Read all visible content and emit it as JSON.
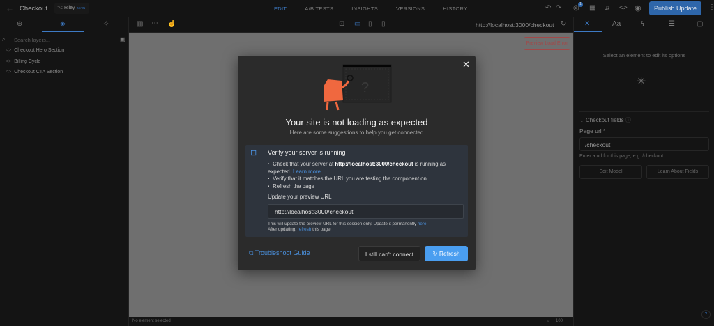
{
  "topbar": {
    "title": "Checkout",
    "user": "Riley",
    "branch": "MAIN",
    "tabs": [
      "EDIT",
      "A/B TESTS",
      "INSIGHTS",
      "VERSIONS",
      "HISTORY"
    ],
    "notif_count": "1",
    "publish": "Publish Update"
  },
  "left": {
    "search_placeholder": "Search layers...",
    "layers": [
      "Checkout Hero Section",
      "Billing Cycle",
      "Checkout CTA Section"
    ]
  },
  "canvas": {
    "url": "http://localhost:3000/checkout",
    "error_badge": "Preview Load Error",
    "status": "No element selected",
    "zoom": "100"
  },
  "right": {
    "hint": "Select an element to edit its options",
    "section": "Checkout fields",
    "field_label": "Page url *",
    "field_value": "/checkout",
    "field_help": "Enter a url for this page, e.g. /checkout",
    "btn_edit": "Edit Model",
    "btn_learn": "Learn About Fields",
    "help": "?"
  },
  "modal": {
    "title": "Your site is not loading as expected",
    "subtitle": "Here are some suggestions to help you get connected",
    "box_title": "Verify your server is running",
    "b1_pre": "Check that your server at ",
    "b1_url": "http://localhost:3000/checkout",
    "b1_post": " is running as expected. ",
    "learn_more": "Learn more",
    "b2": "Verify that it matches the URL you are testing the component on",
    "b3": "Refresh the page",
    "update_label": "Update your preview URL",
    "url_value": "http://localhost:3000/checkout",
    "note1": "This will update the preview URL for this session only. Update it permanently ",
    "here": "here",
    "note2a": "After updating, ",
    "refresh_link": "refresh",
    "note2b": " this page.",
    "troubleshoot": "Troubleshoot Guide",
    "cant_connect": "I still can't connect",
    "refresh": "Refresh"
  }
}
